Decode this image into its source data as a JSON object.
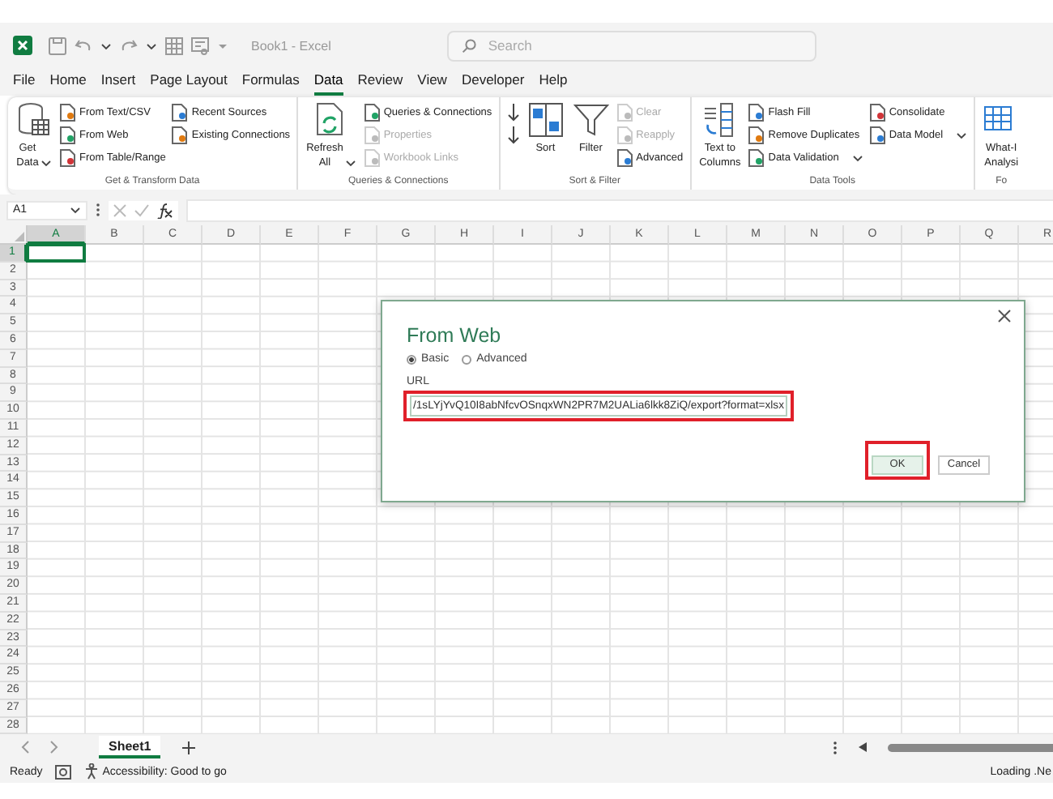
{
  "title_bar": {
    "title": "Book1 - Excel",
    "search": {
      "placeholder": "Search"
    }
  },
  "menu": [
    {
      "label": "File",
      "selected": false
    },
    {
      "label": "Home",
      "selected": false
    },
    {
      "label": "Insert",
      "selected": false
    },
    {
      "label": "Page Layout",
      "selected": false
    },
    {
      "label": "Formulas",
      "selected": false
    },
    {
      "label": "Data",
      "selected": true
    },
    {
      "label": "Review",
      "selected": false
    },
    {
      "label": "View",
      "selected": false
    },
    {
      "label": "Developer",
      "selected": false
    },
    {
      "label": "Help",
      "selected": false
    }
  ],
  "ribbon": {
    "groups": [
      {
        "label": "Get & Transform Data",
        "items": [
          {
            "kind": "large",
            "label": "Get\nData",
            "caret": true,
            "disabled": false
          },
          {
            "kind": "small",
            "label": "From Text/CSV",
            "caret": false,
            "disabled": false
          },
          {
            "kind": "small",
            "label": "From Web",
            "caret": false,
            "disabled": false
          },
          {
            "kind": "small",
            "label": "From Table/Range",
            "caret": false,
            "disabled": false
          },
          {
            "kind": "small",
            "label": "Recent Sources",
            "caret": false,
            "disabled": false
          },
          {
            "kind": "small",
            "label": "Existing Connections",
            "caret": false,
            "disabled": false
          }
        ]
      },
      {
        "label": "Queries & Connections",
        "items": [
          {
            "kind": "large",
            "label": "Refresh\nAll",
            "caret": true,
            "disabled": false
          },
          {
            "kind": "small",
            "label": "Queries & Connections",
            "caret": false,
            "disabled": false
          },
          {
            "kind": "small",
            "label": "Properties",
            "caret": false,
            "disabled": true
          },
          {
            "kind": "small",
            "label": "Workbook Links",
            "caret": false,
            "disabled": true
          }
        ]
      },
      {
        "label": "Sort & Filter",
        "items": [
          {
            "kind": "icon",
            "caret": false,
            "disabled": false
          },
          {
            "kind": "icon",
            "caret": false,
            "disabled": false
          },
          {
            "kind": "large",
            "label": "Sort",
            "caret": false,
            "disabled": false
          },
          {
            "kind": "large",
            "label": "Filter",
            "caret": false,
            "disabled": false
          },
          {
            "kind": "small",
            "label": "Clear",
            "caret": false,
            "disabled": true
          },
          {
            "kind": "small",
            "label": "Reapply",
            "caret": false,
            "disabled": true
          },
          {
            "kind": "small",
            "label": "Advanced",
            "caret": false,
            "disabled": false
          }
        ]
      },
      {
        "label": "Data Tools",
        "items": [
          {
            "kind": "large",
            "label": "Text to\nColumns",
            "caret": false,
            "disabled": false
          },
          {
            "kind": "small",
            "label": "Flash Fill",
            "caret": false,
            "disabled": false
          },
          {
            "kind": "small",
            "label": "Remove Duplicates",
            "caret": false,
            "disabled": false
          },
          {
            "kind": "small",
            "label": "Data Validation",
            "caret": true,
            "disabled": false
          },
          {
            "kind": "small",
            "label": "Consolidate",
            "caret": false,
            "disabled": false
          },
          {
            "kind": "small",
            "label": "Data Model",
            "caret": true,
            "disabled": false
          }
        ]
      },
      {
        "label": "Fo",
        "items": [
          {
            "kind": "large",
            "label": "What-I\nAnalysi",
            "caret": false,
            "disabled": false
          }
        ]
      }
    ]
  },
  "formula_bar": {
    "name_box": "A1"
  },
  "columns": [
    {
      "label": "A",
      "selected": true
    },
    {
      "label": "B",
      "selected": false
    },
    {
      "label": "C",
      "selected": false
    },
    {
      "label": "D",
      "selected": false
    },
    {
      "label": "E",
      "selected": false
    },
    {
      "label": "F",
      "selected": false
    },
    {
      "label": "G",
      "selected": false
    },
    {
      "label": "H",
      "selected": false
    },
    {
      "label": "I",
      "selected": false
    },
    {
      "label": "J",
      "selected": false
    },
    {
      "label": "K",
      "selected": false
    },
    {
      "label": "L",
      "selected": false
    },
    {
      "label": "M",
      "selected": false
    },
    {
      "label": "N",
      "selected": false
    },
    {
      "label": "O",
      "selected": false
    },
    {
      "label": "P",
      "selected": false
    },
    {
      "label": "Q",
      "selected": false
    },
    {
      "label": "R",
      "selected": false
    }
  ],
  "rows": [
    {
      "label": "1",
      "selected": true
    },
    {
      "label": "2",
      "selected": false
    },
    {
      "label": "3",
      "selected": false
    },
    {
      "label": "4",
      "selected": false
    },
    {
      "label": "5",
      "selected": false
    },
    {
      "label": "6",
      "selected": false
    },
    {
      "label": "7",
      "selected": false
    },
    {
      "label": "8",
      "selected": false
    },
    {
      "label": "9",
      "selected": false
    },
    {
      "label": "10",
      "selected": false
    },
    {
      "label": "11",
      "selected": false
    },
    {
      "label": "12",
      "selected": false
    },
    {
      "label": "13",
      "selected": false
    },
    {
      "label": "14",
      "selected": false
    },
    {
      "label": "15",
      "selected": false
    },
    {
      "label": "16",
      "selected": false
    },
    {
      "label": "17",
      "selected": false
    },
    {
      "label": "18",
      "selected": false
    },
    {
      "label": "19",
      "selected": false
    },
    {
      "label": "20",
      "selected": false
    },
    {
      "label": "21",
      "selected": false
    },
    {
      "label": "22",
      "selected": false
    },
    {
      "label": "23",
      "selected": false
    },
    {
      "label": "24",
      "selected": false
    },
    {
      "label": "25",
      "selected": false
    },
    {
      "label": "26",
      "selected": false
    },
    {
      "label": "27",
      "selected": false
    },
    {
      "label": "28",
      "selected": false
    }
  ],
  "dialog": {
    "title": "From Web",
    "modes": [
      {
        "label": "Basic",
        "selected": true
      },
      {
        "label": "Advanced",
        "selected": false
      }
    ],
    "url": {
      "label": "URL",
      "value": "/1sLYjYvQ10I8abNfcvOSnqxWN2PR7M2UALia6lkk8ZiQ/export?format=xlsx",
      "highlighted": true
    },
    "buttons": [
      {
        "label": "OK",
        "default": true,
        "highlighted": true
      },
      {
        "label": "Cancel",
        "default": false,
        "highlighted": false
      }
    ]
  },
  "sheet_tabs": [
    {
      "label": "Sheet1",
      "selected": true
    }
  ],
  "status_bar": {
    "mode": "Ready",
    "accessibility": "Accessibility: Good to go",
    "right": "Loading .Ne"
  }
}
